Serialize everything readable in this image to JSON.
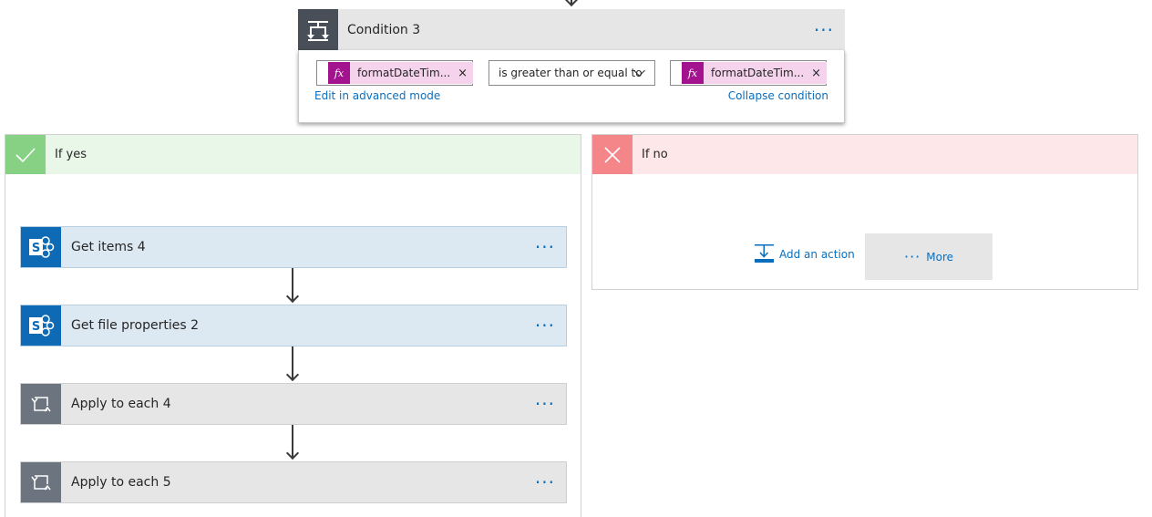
{
  "condition": {
    "title": "Condition 3",
    "more_dots": "···",
    "left_token": {
      "fx": "fx",
      "label": "formatDateTim...",
      "remove": "×"
    },
    "operator": "is greater than or equal to",
    "right_token": {
      "fx": "fx",
      "label": "formatDateTim...",
      "remove": "×"
    },
    "edit_advanced_label": "Edit in advanced mode",
    "collapse_label": "Collapse condition"
  },
  "branch_yes": {
    "title": "If yes",
    "actions": [
      {
        "title": "Get items 4",
        "icon": "sharepoint-icon",
        "more": "···"
      },
      {
        "title": "Get file properties 2",
        "icon": "sharepoint-icon",
        "more": "···"
      },
      {
        "title": "Apply to each 4",
        "icon": "loop-icon",
        "more": "···"
      },
      {
        "title": "Apply to each 5",
        "icon": "loop-icon",
        "more": "···"
      }
    ]
  },
  "branch_no": {
    "title": "If no",
    "add_action_label": "Add an action",
    "more_dots": "···",
    "more_label": "More"
  },
  "colors": {
    "accent_link": "#0a6ebd",
    "yes_badge": "#86d184",
    "no_badge": "#f4868a",
    "sharepoint": "#0f6ab5",
    "expression_token": "#a4138e"
  }
}
